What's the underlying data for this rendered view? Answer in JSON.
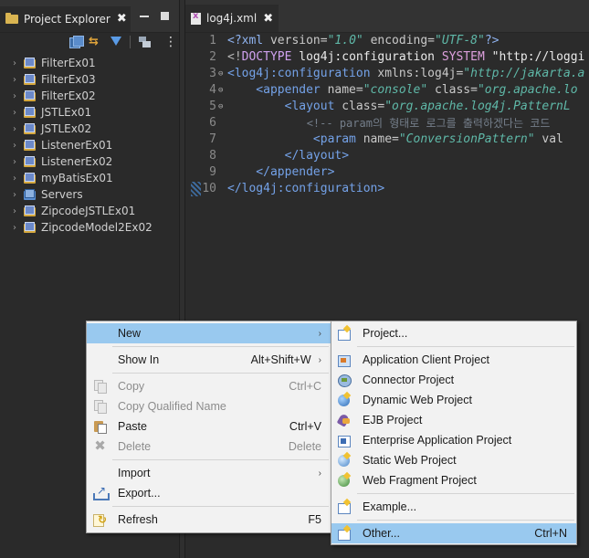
{
  "explorer": {
    "title": "Project Explorer",
    "projects": [
      {
        "name": "FilterEx01",
        "icon": "web-project-icon"
      },
      {
        "name": "FilterEx03",
        "icon": "web-project-icon"
      },
      {
        "name": "FilterEx02",
        "icon": "web-project-icon"
      },
      {
        "name": "JSTLEx01",
        "icon": "web-project-icon"
      },
      {
        "name": "JSTLEx02",
        "icon": "web-project-icon"
      },
      {
        "name": "ListenerEx01",
        "icon": "web-project-icon"
      },
      {
        "name": "ListenerEx02",
        "icon": "web-project-icon"
      },
      {
        "name": "myBatisEx01",
        "icon": "web-project-icon"
      },
      {
        "name": "Servers",
        "icon": "servers-folder-icon"
      },
      {
        "name": "ZipcodeJSTLEx01",
        "icon": "web-project-icon"
      },
      {
        "name": "ZipcodeModel2Ex02",
        "icon": "web-project-icon"
      }
    ]
  },
  "editor": {
    "tab_title": "log4j.xml",
    "lines": [
      {
        "num": "1",
        "fold": "",
        "tokens": [
          {
            "c": "t-pi",
            "t": "<?xml "
          },
          {
            "c": "t-attr",
            "t": "version="
          },
          {
            "c": "t-val",
            "t": "\"1.0\" "
          },
          {
            "c": "t-attr",
            "t": "encoding="
          },
          {
            "c": "t-val",
            "t": "\"UTF-8\""
          },
          {
            "c": "t-pi",
            "t": "?>"
          }
        ]
      },
      {
        "num": "2",
        "fold": "",
        "tokens": [
          {
            "c": "t-punc",
            "t": "<!"
          },
          {
            "c": "t-doct",
            "t": "DOCTYPE "
          },
          {
            "c": "t-str",
            "t": "log4j:configuration "
          },
          {
            "c": "t-kw",
            "t": "SYSTEM "
          },
          {
            "c": "t-str",
            "t": "\"http://loggi"
          }
        ]
      },
      {
        "num": "3",
        "fold": "⊖",
        "tokens": [
          {
            "c": "t-tag",
            "t": "<log4j:configuration "
          },
          {
            "c": "t-attr",
            "t": "xmlns:log4j="
          },
          {
            "c": "t-val",
            "t": "\"http://jakarta.a"
          }
        ]
      },
      {
        "num": "4",
        "fold": "⊖",
        "tokens": [
          {
            "c": "t-tag",
            "t": "    <appender "
          },
          {
            "c": "t-attr",
            "t": "name="
          },
          {
            "c": "t-val",
            "t": "\"console\" "
          },
          {
            "c": "t-attr",
            "t": "class="
          },
          {
            "c": "t-val",
            "t": "\"org.apache.lo"
          }
        ]
      },
      {
        "num": "5",
        "fold": "⊖",
        "tokens": [
          {
            "c": "t-tag",
            "t": "        <layout "
          },
          {
            "c": "t-attr",
            "t": "class="
          },
          {
            "c": "t-val",
            "t": "\"org.apache.log4j.PatternL"
          }
        ]
      },
      {
        "num": "6",
        "fold": "",
        "tokens": [
          {
            "c": "t-cmt",
            "t": "            <!-- param의 형태로 로그를 출력하겠다는 코드"
          }
        ]
      },
      {
        "num": "7",
        "fold": "",
        "tokens": [
          {
            "c": "t-tag",
            "t": "            <param "
          },
          {
            "c": "t-attr",
            "t": "name="
          },
          {
            "c": "t-val",
            "t": "\"ConversionPattern\" "
          },
          {
            "c": "t-attr",
            "t": "val"
          }
        ]
      },
      {
        "num": "8",
        "fold": "",
        "tokens": [
          {
            "c": "t-tag",
            "t": "        </layout>"
          }
        ]
      },
      {
        "num": "9",
        "fold": "",
        "tokens": [
          {
            "c": "t-tag",
            "t": "    </appender>"
          }
        ]
      },
      {
        "num": "10",
        "fold": "",
        "current": true,
        "tokens": [
          {
            "c": "t-tag",
            "t": "</log4j:configuration>"
          }
        ]
      }
    ]
  },
  "context_menu": {
    "items": [
      {
        "type": "item",
        "name": "menu-new",
        "label": "New",
        "accel": "",
        "submenu": true,
        "highlight": true,
        "icon": ""
      },
      {
        "type": "sep"
      },
      {
        "type": "item",
        "name": "menu-show-in",
        "label": "Show In",
        "accel": "Alt+Shift+W",
        "submenu": true,
        "icon": ""
      },
      {
        "type": "sep"
      },
      {
        "type": "item",
        "name": "menu-copy",
        "label": "Copy",
        "accel": "Ctrl+C",
        "disabled": true,
        "icon": "copy-icon"
      },
      {
        "type": "item",
        "name": "menu-copy-qualified-name",
        "label": "Copy Qualified Name",
        "accel": "",
        "disabled": true,
        "icon": "copy-icon"
      },
      {
        "type": "item",
        "name": "menu-paste",
        "label": "Paste",
        "accel": "Ctrl+V",
        "icon": "paste-icon"
      },
      {
        "type": "item",
        "name": "menu-delete",
        "label": "Delete",
        "accel": "Delete",
        "disabled": true,
        "icon": "delete-icon"
      },
      {
        "type": "sep"
      },
      {
        "type": "item",
        "name": "menu-import",
        "label": "Import",
        "accel": "",
        "submenu": true,
        "icon": ""
      },
      {
        "type": "item",
        "name": "menu-export",
        "label": "Export...",
        "accel": "",
        "icon": "export-icon"
      },
      {
        "type": "sep"
      },
      {
        "type": "item",
        "name": "menu-refresh",
        "label": "Refresh",
        "accel": "F5",
        "icon": "refresh-icon"
      }
    ]
  },
  "new_submenu": {
    "items": [
      {
        "type": "item",
        "name": "new-project",
        "label": "Project...",
        "icon": "wiz-project"
      },
      {
        "type": "sep"
      },
      {
        "type": "item",
        "name": "new-application-client-project",
        "label": "Application Client Project",
        "icon": "wiz-appclient"
      },
      {
        "type": "item",
        "name": "new-connector-project",
        "label": "Connector Project",
        "icon": "wiz-connector"
      },
      {
        "type": "item",
        "name": "new-dynamic-web-project",
        "label": "Dynamic Web Project",
        "icon": "wiz-dynweb"
      },
      {
        "type": "item",
        "name": "new-ejb-project",
        "label": "EJB Project",
        "icon": "wiz-ejb"
      },
      {
        "type": "item",
        "name": "new-enterprise-application-project",
        "label": "Enterprise Application Project",
        "icon": "wiz-ear"
      },
      {
        "type": "item",
        "name": "new-static-web-project",
        "label": "Static Web Project",
        "icon": "wiz-staticweb"
      },
      {
        "type": "item",
        "name": "new-web-fragment-project",
        "label": "Web Fragment Project",
        "icon": "wiz-webfrag"
      },
      {
        "type": "sep"
      },
      {
        "type": "item",
        "name": "new-example",
        "label": "Example...",
        "icon": "wiz-example"
      },
      {
        "type": "sep"
      },
      {
        "type": "item",
        "name": "new-other",
        "label": "Other...",
        "accel": "Ctrl+N",
        "highlight": true,
        "icon": "wiz-other"
      }
    ]
  }
}
